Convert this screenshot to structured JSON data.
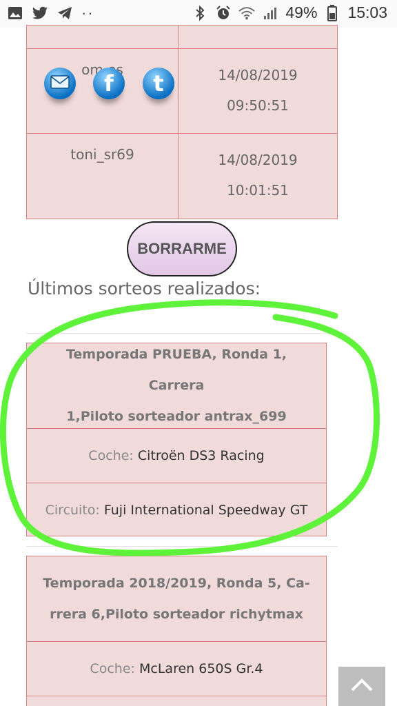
{
  "status_bar": {
    "battery": "49%",
    "time": "15:03",
    "dots": "··"
  },
  "top_table": {
    "rows": [
      {
        "user": "",
        "date": "",
        "time": ""
      },
      {
        "user": "om    es",
        "date": "14/08/2019",
        "time": "09:50:51"
      },
      {
        "user": "toni_sr69",
        "date": "14/08/2019",
        "time": "10:01:51"
      }
    ]
  },
  "share_icons": [
    "email-icon",
    "facebook-icon",
    "twitter-icon"
  ],
  "borrarme_button": "BORRARME",
  "section_title": "Últimos sorteos realizados:",
  "draws": [
    {
      "title_line1": "Temporada PRUEBA, Ronda 1, Carrera",
      "title_line2": "1,Piloto sorteador antrax_699",
      "car_label": "Coche:",
      "car_value": "Citroën DS3 Racing",
      "circuit_label": "Circuito:",
      "circuit_value": "Fuji International Speedway GT"
    },
    {
      "title_line1": "Temporada 2018/2019, Ronda 5, Ca-",
      "title_line2": "rrera 6,Piloto sorteador richytmax",
      "car_label": "Coche:",
      "car_value": "McLaren 650S Gr.4"
    }
  ],
  "colors": {
    "cell_bg": "#f1dada",
    "cell_border": "#d98080",
    "highlight_stroke": "#5ef23a",
    "button_bg": "#e9d3ec"
  }
}
